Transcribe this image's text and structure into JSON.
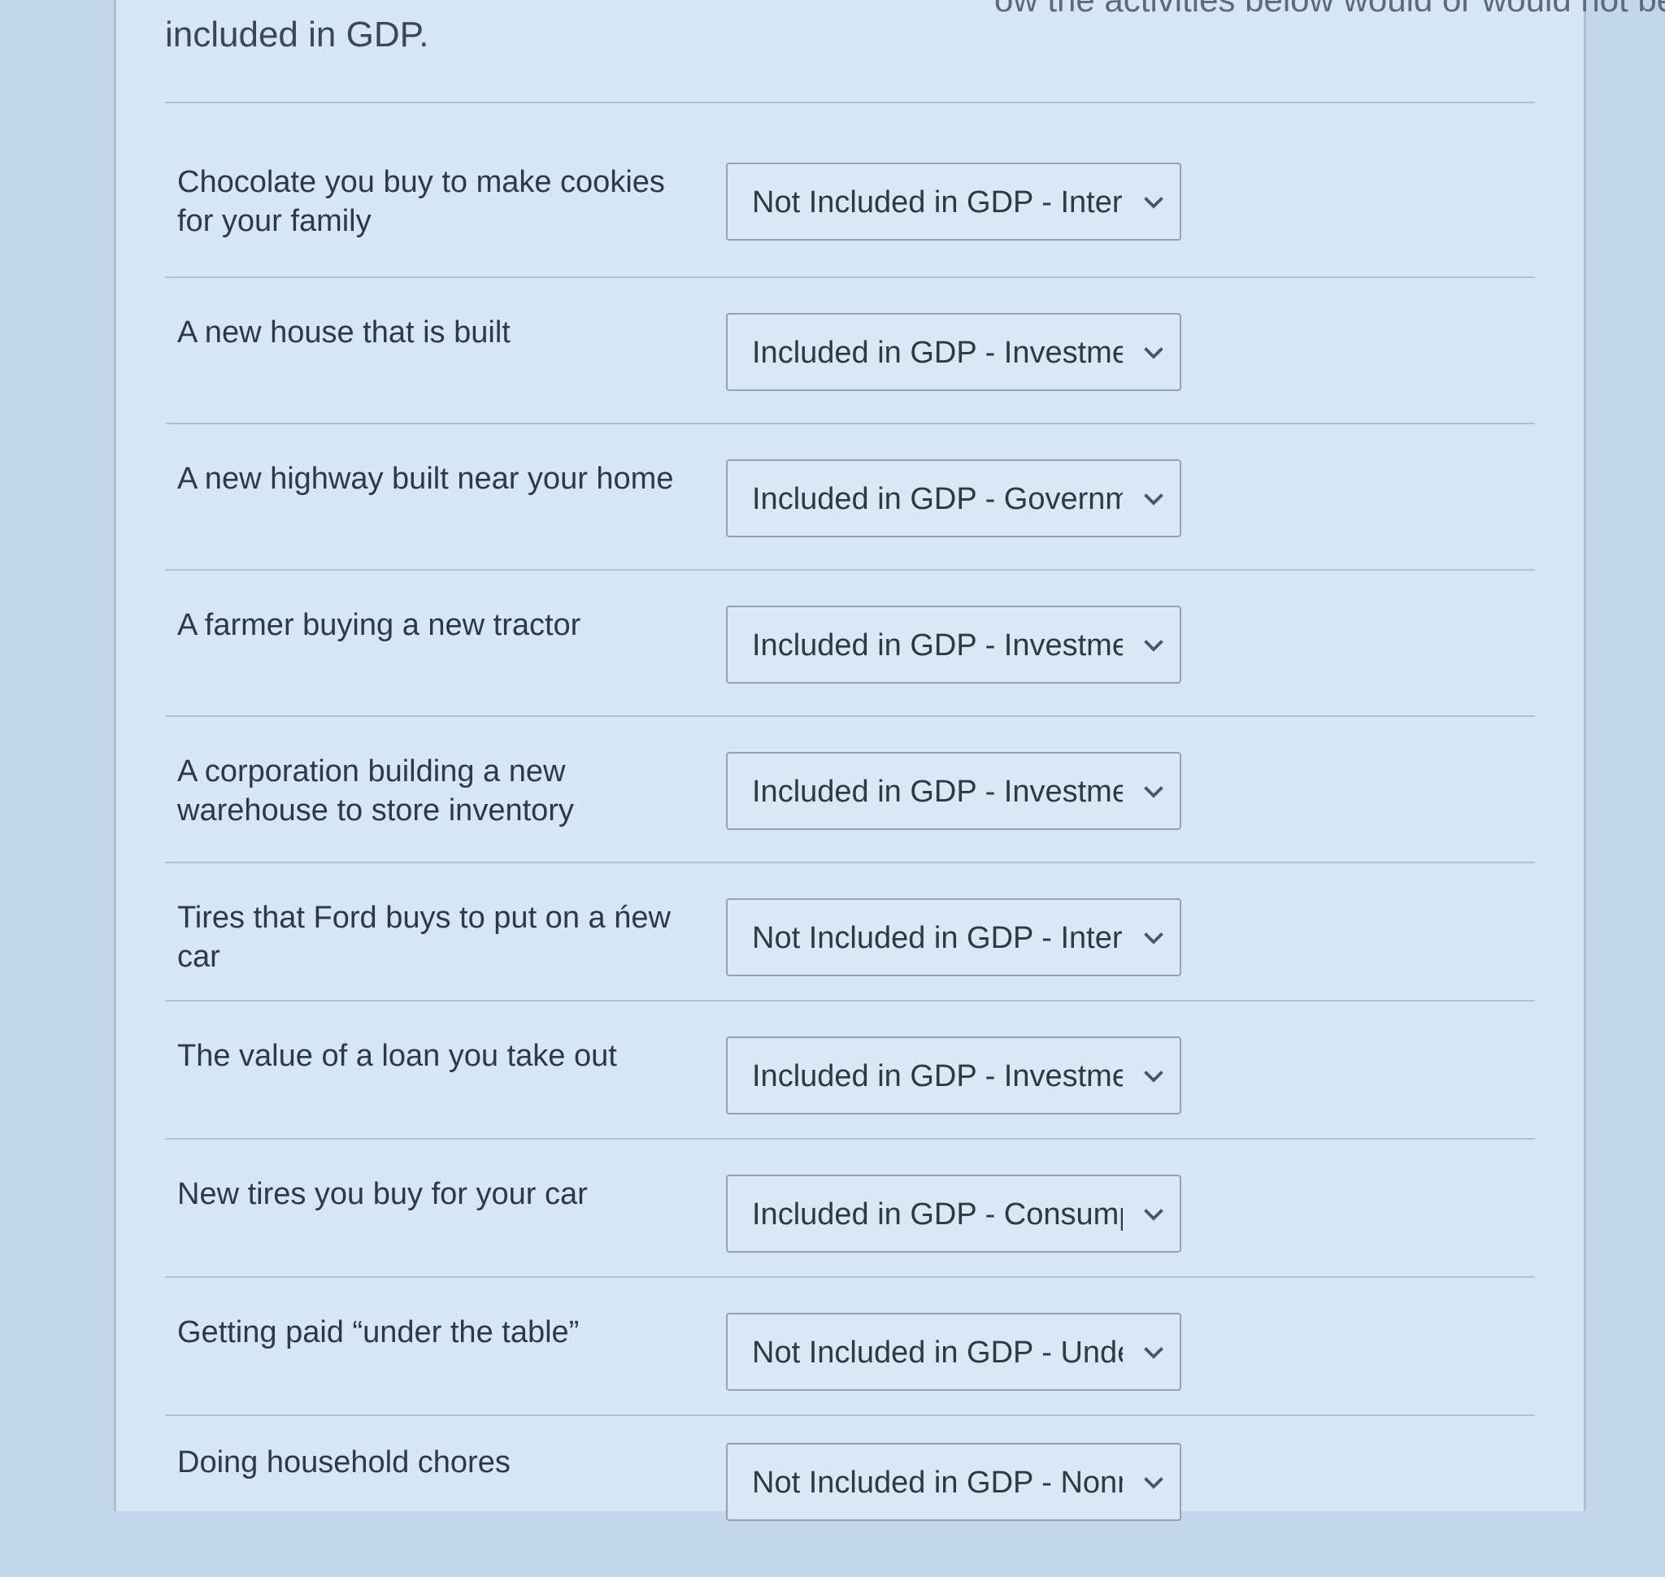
{
  "question": {
    "top_fragment": "ow the activities below would or would not be",
    "text": "included in GDP."
  },
  "rows": [
    {
      "label": "Chocolate you buy to make cookies for your family",
      "selected": "Not Included in GDP - Interme"
    },
    {
      "label": "A new house that is built",
      "selected": "Included in GDP - Investment"
    },
    {
      "label": "A new highway built near your home",
      "selected": "Included in GDP - Governmen"
    },
    {
      "label": "A farmer buying a new tractor",
      "selected": "Included in GDP - Investment"
    },
    {
      "label": "A corporation building a new warehouse to store inventory",
      "selected": "Included in GDP - Investment"
    },
    {
      "label": "Tires that Ford buys to put on a ńew car",
      "selected": "Not Included in GDP - Interme"
    },
    {
      "label": "The value of a loan you take out",
      "selected": "Included in GDP - Investment"
    },
    {
      "label": "New tires you buy for your car",
      "selected": "Included in GDP - Consumptic"
    },
    {
      "label": "Getting paid “under the table”",
      "selected": "Not Included in GDP - Underg"
    },
    {
      "label": "Doing household chores",
      "selected": "Not Included in GDP - Nonma"
    }
  ],
  "icons": {
    "dropdown": "chevron-down-icon"
  }
}
